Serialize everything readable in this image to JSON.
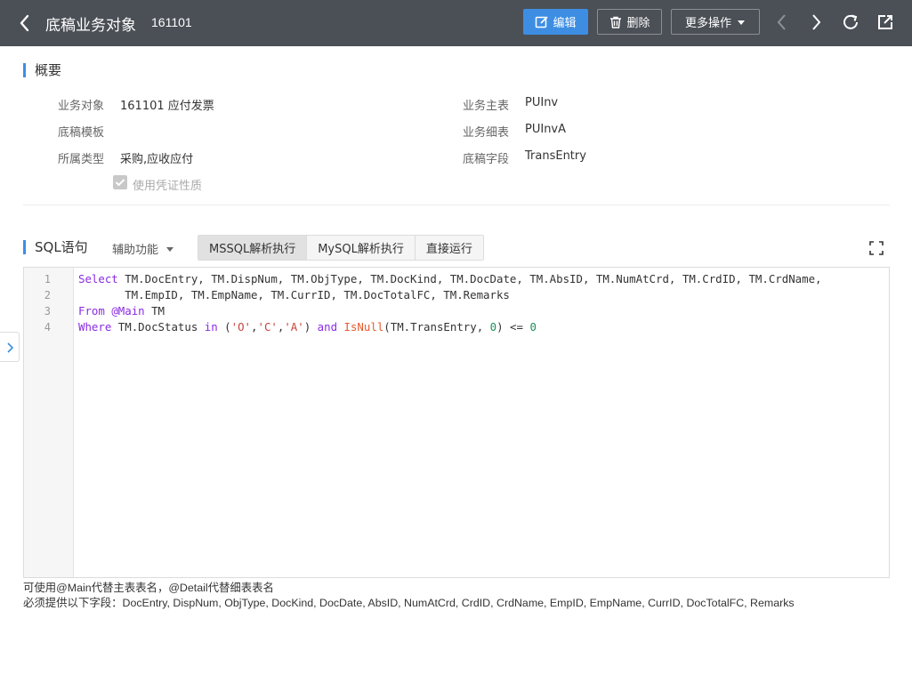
{
  "header": {
    "title": "底稿业务对象",
    "code": "161101",
    "edit_label": "编辑",
    "delete_label": "删除",
    "more_label": "更多操作"
  },
  "overview": {
    "title": "概要",
    "fields": {
      "biz_object_label": "业务对象",
      "biz_object_value": "161101 应付发票",
      "template_label": "底稿模板",
      "template_value": "",
      "type_label": "所属类型",
      "type_value": "采购,应收应付",
      "main_table_label": "业务主表",
      "main_table_value": "PUInv",
      "detail_table_label": "业务细表",
      "detail_table_value": "PUInvA",
      "field_label": "底稿字段",
      "field_value": "TransEntry"
    },
    "checkbox_label": "使用凭证性质",
    "checkbox_checked": true
  },
  "sql": {
    "title": "SQL语句",
    "assist_label": "辅助功能",
    "tabs": [
      "MSSQL解析执行",
      "MySQL解析执行",
      "直接运行"
    ],
    "active_tab": 0,
    "line_numbers": [
      "1",
      "2",
      "3",
      "4"
    ],
    "line1": "TM.DocEntry, TM.DispNum, TM.ObjType, TM.DocKind, TM.DocDate, TM.AbsID, TM.NumAtCrd, TM.CrdID, TM.CrdName,",
    "line2": "       TM.EmpID, TM.EmpName, TM.CurrID, TM.DocTotalFC, TM.Remarks",
    "kw_select": "Select",
    "kw_from": "From",
    "main_ref": "@Main",
    "alias": "TM",
    "kw_where": "Where",
    "status_field": "TM.DocStatus",
    "kw_in": "in",
    "str_o": "'O'",
    "str_c": "'C'",
    "str_a": "'A'",
    "kw_and": "and",
    "fn_isnull": "IsNull",
    "trans_field": "TM.TransEntry",
    "num_zero": "0",
    "op_le": "<=",
    "num_zero2": "0"
  },
  "notes": {
    "line1": "可使用@Main代替主表表名，@Detail代替细表表名",
    "line2": "必须提供以下字段：DocEntry, DispNum, ObjType, DocKind, DocDate, AbsID, NumAtCrd, CrdID, CrdName, EmpID, EmpName, CurrID, DocTotalFC, Remarks"
  },
  "icons": [
    "back-icon",
    "edit-icon",
    "trash-icon",
    "caret-down-icon",
    "prev-icon",
    "next-icon",
    "refresh-icon",
    "external-link-icon",
    "fullscreen-icon",
    "expand-sidebar-icon",
    "check-icon"
  ],
  "colors": {
    "header_bg": "#4b4f56",
    "accent": "#3d8ee3"
  }
}
